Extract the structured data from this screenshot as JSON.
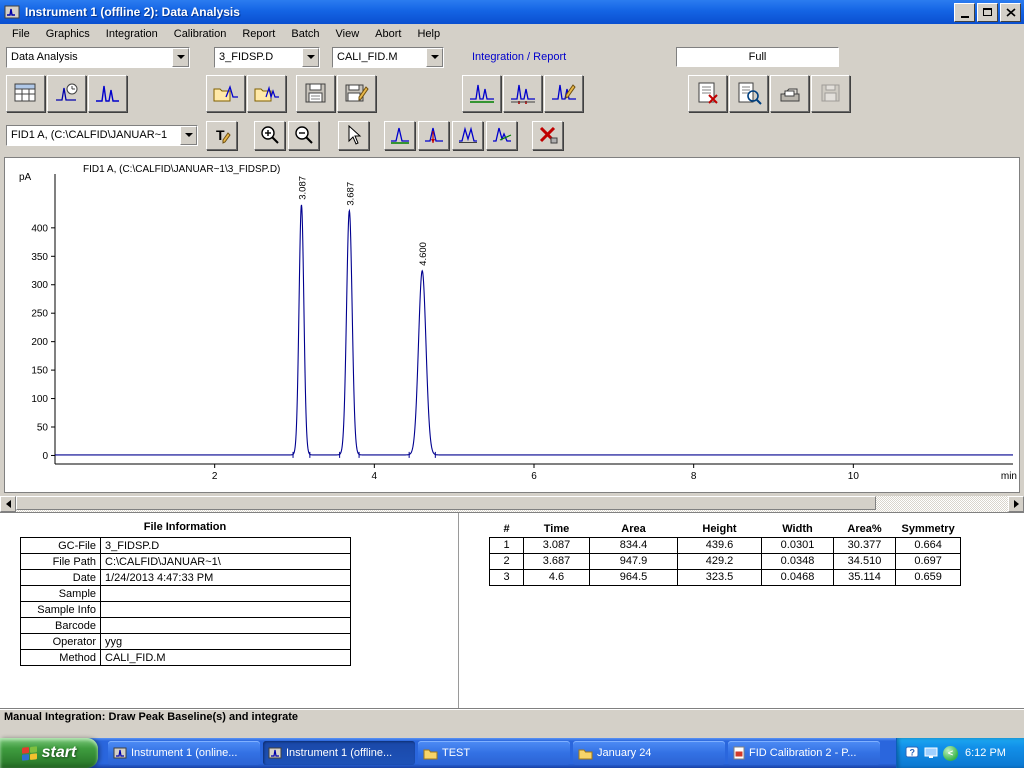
{
  "window": {
    "title": "Instrument 1 (offline 2): Data Analysis"
  },
  "menu": {
    "items": [
      "File",
      "Graphics",
      "Integration",
      "Calibration",
      "Report",
      "Batch",
      "View",
      "Abort",
      "Help"
    ]
  },
  "toolbars": {
    "mode_combo": "Data Analysis",
    "data_file_combo": "3_FIDSP.D",
    "method_combo": "CALI_FID.M",
    "section_label": "Integration / Report",
    "view_combo": "Full",
    "signal_combo": "FID1 A, (C:\\CALFID\\JANUAR~1"
  },
  "icons": {
    "toolbar_row2": [
      "data-table",
      "signal-options",
      "chromatogram",
      "load-signal",
      "load-more-signals",
      "save-method",
      "save-method-as",
      "integrate",
      "auto-integrate",
      "manual-integration-events",
      "report-export",
      "report-preview",
      "print-report",
      "report-disabled"
    ],
    "toolbar_row3": [
      "annotate-text",
      "zoom-in",
      "zoom-out",
      "pointer",
      "draw-baseline",
      "drop-perpendicular",
      "valley-baseline",
      "tangent-skim",
      "delete-integration"
    ]
  },
  "chart_data": {
    "type": "line",
    "title": "FID1 A, (C:\\CALFID\\JANUAR~1\\3_FIDSP.D)",
    "ylabel": "pA",
    "xlabel": "min",
    "xlim": [
      0,
      12
    ],
    "ylim": [
      -15,
      470
    ],
    "xticks": [
      2,
      4,
      6,
      8,
      10
    ],
    "yticks": [
      0,
      50,
      100,
      150,
      200,
      250,
      300,
      350,
      400
    ],
    "baseline": 1,
    "grid": false,
    "line_color": "#00008f",
    "peaks": [
      {
        "time": 3.087,
        "height": 439.6,
        "width": 0.0301,
        "label": "3.087"
      },
      {
        "time": 3.687,
        "height": 429.2,
        "width": 0.0348,
        "label": "3.687"
      },
      {
        "time": 4.6,
        "height": 323.5,
        "width": 0.0468,
        "label": "4.600"
      }
    ]
  },
  "file_info": {
    "title": "File Information",
    "rows": [
      {
        "label": "GC-File",
        "value": "3_FIDSP.D"
      },
      {
        "label": "File Path",
        "value": "C:\\CALFID\\JANUAR~1\\"
      },
      {
        "label": "Date",
        "value": "1/24/2013 4:47:33 PM"
      },
      {
        "label": "Sample",
        "value": ""
      },
      {
        "label": "Sample Info",
        "value": ""
      },
      {
        "label": "Barcode",
        "value": ""
      },
      {
        "label": "Operator",
        "value": "yyg"
      },
      {
        "label": "Method",
        "value": "CALI_FID.M"
      }
    ]
  },
  "peak_table": {
    "headers": [
      "#",
      "Time",
      "Area",
      "Height",
      "Width",
      "Area%",
      "Symmetry"
    ],
    "rows": [
      [
        "1",
        "3.087",
        "834.4",
        "439.6",
        "0.0301",
        "30.377",
        "0.664"
      ],
      [
        "2",
        "3.687",
        "947.9",
        "429.2",
        "0.0348",
        "34.510",
        "0.697"
      ],
      [
        "3",
        "4.6",
        "964.5",
        "323.5",
        "0.0468",
        "35.114",
        "0.659"
      ]
    ]
  },
  "status_bar": {
    "text": "Manual Integration: Draw Peak Baseline(s) and integrate"
  },
  "taskbar": {
    "start_label": "start",
    "tasks": [
      {
        "label": "Instrument 1 (online...",
        "active": false
      },
      {
        "label": "Instrument 1 (offline...",
        "active": true
      },
      {
        "label": "TEST",
        "active": false
      },
      {
        "label": "January 24",
        "active": false
      },
      {
        "label": "FID Calibration 2 - P...",
        "active": false
      }
    ],
    "tray_time": "6:12 PM"
  }
}
